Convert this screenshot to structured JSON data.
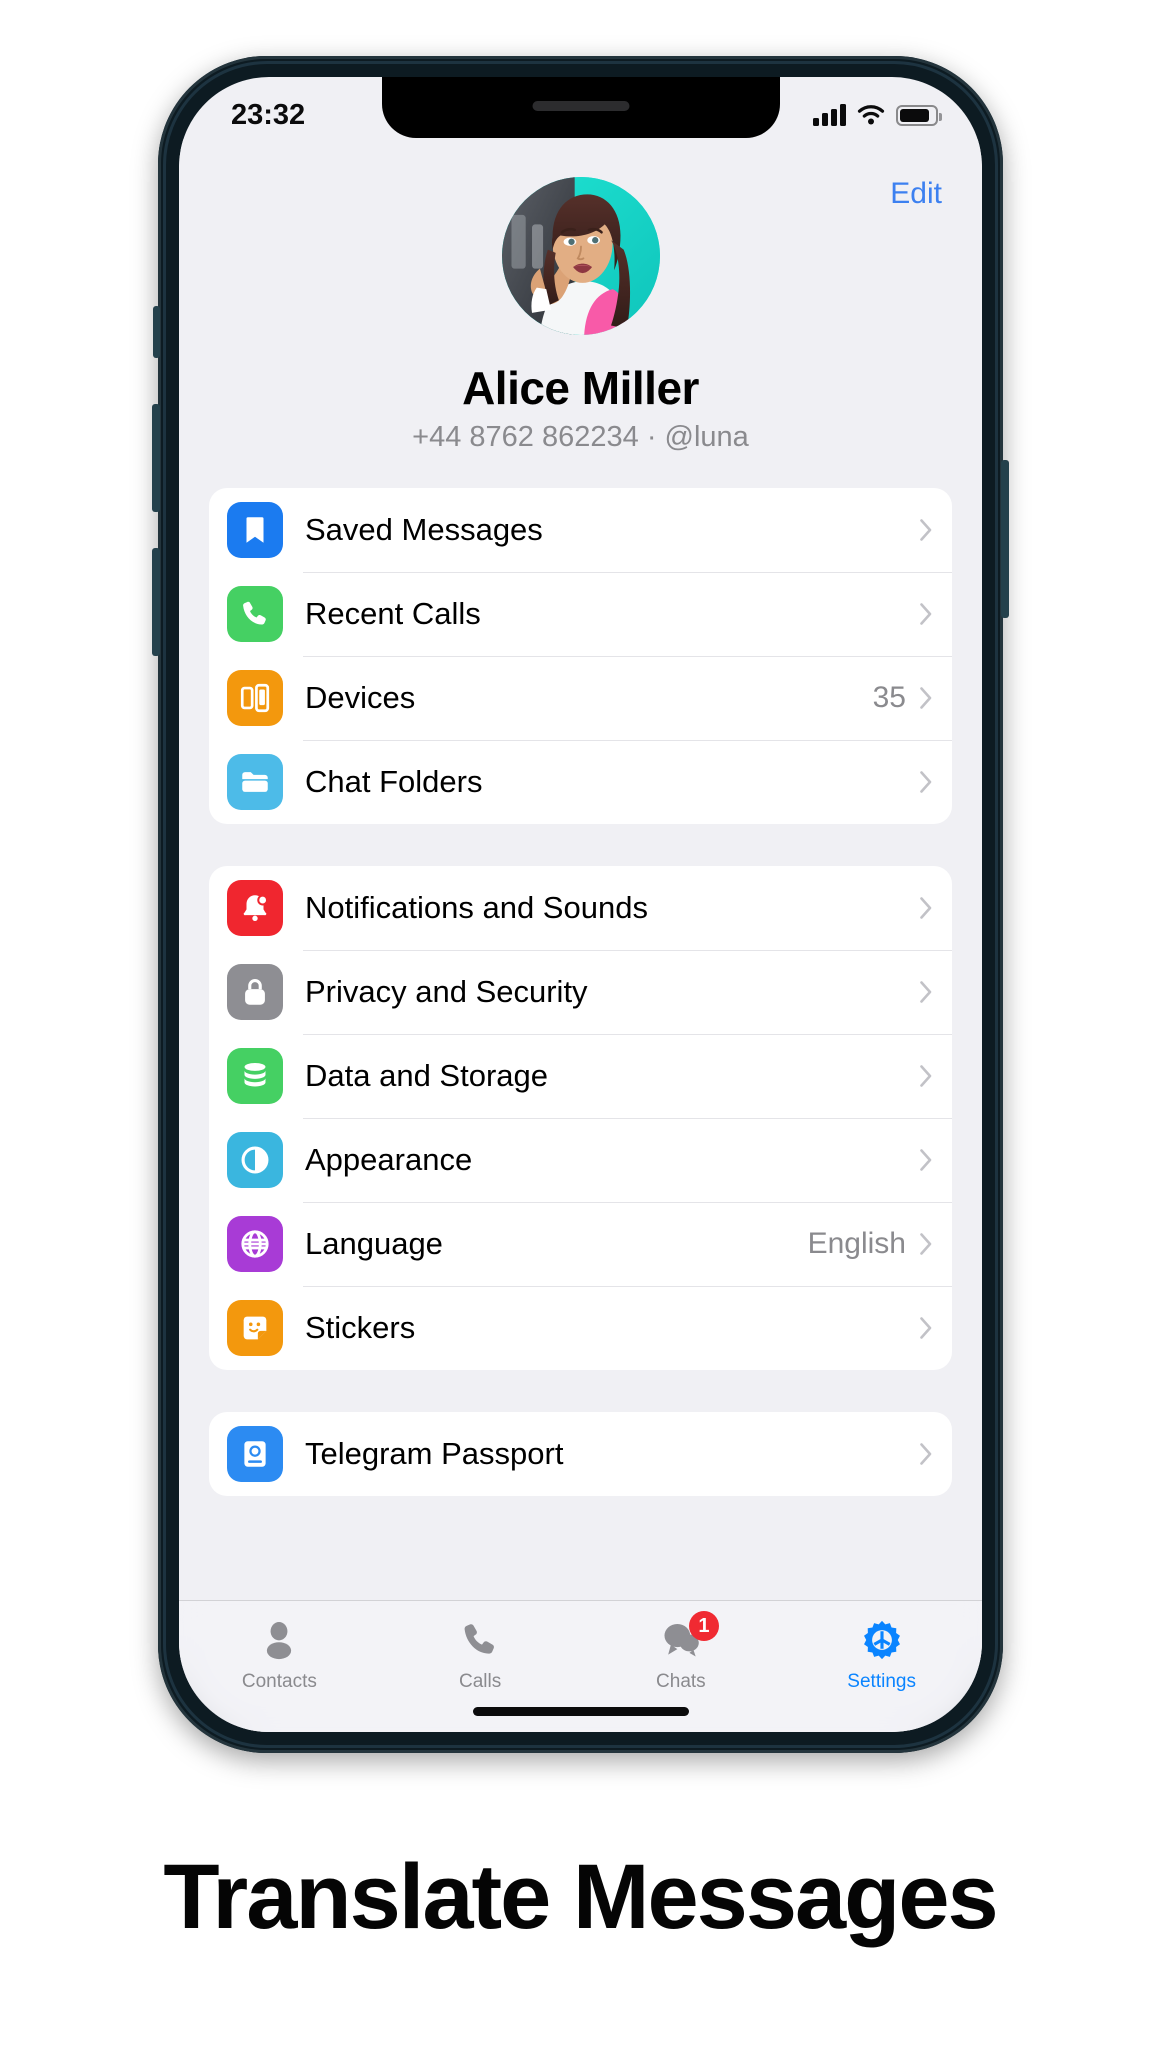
{
  "caption": "Translate Messages",
  "statusbar": {
    "time": "23:32",
    "signal_icon": "cellular-bars-icon",
    "wifi_icon": "wifi-icon",
    "battery_icon": "battery-icon"
  },
  "header": {
    "edit_label": "Edit"
  },
  "profile": {
    "name": "Alice Miller",
    "subtitle": "+44 8762 862234 · @luna",
    "avatar_name": "avatar"
  },
  "groups": [
    {
      "id": "group-1",
      "rows": [
        {
          "label": "Saved Messages",
          "value": "",
          "icon": "bookmark-icon",
          "color": "#1b7bf0"
        },
        {
          "label": "Recent Calls",
          "value": "",
          "icon": "phone-icon",
          "color": "#45d063"
        },
        {
          "label": "Devices",
          "value": "35",
          "icon": "devices-icon",
          "color": "#f3980d"
        },
        {
          "label": "Chat Folders",
          "value": "",
          "icon": "folder-icon",
          "color": "#4dbbe8"
        }
      ]
    },
    {
      "id": "group-2",
      "rows": [
        {
          "label": "Notifications and Sounds",
          "value": "",
          "icon": "bell-icon",
          "color": "#f0262f"
        },
        {
          "label": "Privacy and Security",
          "value": "",
          "icon": "lock-icon",
          "color": "#8e8e93"
        },
        {
          "label": "Data and Storage",
          "value": "",
          "icon": "database-icon",
          "color": "#45d063"
        },
        {
          "label": "Appearance",
          "value": "",
          "icon": "contrast-icon",
          "color": "#3ab6df"
        },
        {
          "label": "Language",
          "value": "English",
          "icon": "globe-icon",
          "color": "#a83bd6"
        },
        {
          "label": "Stickers",
          "value": "",
          "icon": "sticker-icon",
          "color": "#f3980d"
        }
      ]
    },
    {
      "id": "group-3",
      "rows": [
        {
          "label": "Telegram Passport",
          "value": "",
          "icon": "passport-icon",
          "color": "#2c8bf2"
        }
      ]
    }
  ],
  "tabbar": {
    "tabs": [
      {
        "label": "Contacts",
        "icon": "person-icon",
        "active": false,
        "badge": ""
      },
      {
        "label": "Calls",
        "icon": "phone-icon",
        "active": false,
        "badge": ""
      },
      {
        "label": "Chats",
        "icon": "chats-icon",
        "active": false,
        "badge": "1"
      },
      {
        "label": "Settings",
        "icon": "gear-icon",
        "active": true,
        "badge": ""
      }
    ]
  },
  "colors": {
    "accent": "#0a84ff",
    "edit_blue": "#3c80f0",
    "badge_red": "#f02a32",
    "screen_bg": "#f0f0f4",
    "frame": "#0d1b22"
  }
}
